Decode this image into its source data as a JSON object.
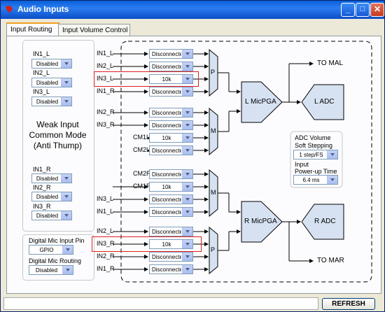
{
  "window": {
    "title": "Audio Inputs",
    "buttons": {
      "minimize": "_",
      "maximize": "□",
      "close": "✕"
    }
  },
  "tabs": [
    {
      "label": "Input Routing"
    },
    {
      "label": "Input Volume Control"
    }
  ],
  "left_panel": {
    "groups": [
      {
        "label": "IN1_L",
        "value": "Disabled"
      },
      {
        "label": "IN2_L",
        "value": "Disabled"
      },
      {
        "label": "IN3_L",
        "value": "Disabled"
      },
      {
        "label": "IN1_R",
        "value": "Disabled"
      },
      {
        "label": "IN2_R",
        "value": "Disabled"
      },
      {
        "label": "IN3_R",
        "value": "Disabled"
      }
    ],
    "weak_input_text": {
      "line1": "Weak Input",
      "line2": "Common Mode",
      "line3": "(Anti Thump)"
    },
    "digital_mic_input_pin": {
      "label": "Digital Mic Input Pin",
      "value": "GPIO"
    },
    "digital_mic_routing": {
      "label": "Digital Mic Routing",
      "value": "Disabled"
    }
  },
  "routing": {
    "rows_top": [
      {
        "label": "IN1_L",
        "value": "Disconnected"
      },
      {
        "label": "IN2_L",
        "value": "Disconnected"
      },
      {
        "label": "IN3_L",
        "value": "10k"
      },
      {
        "label": "IN1_R",
        "value": "Disconnected"
      },
      {
        "label": "IN2_R",
        "value": "Disconnected"
      },
      {
        "label": "IN3_R",
        "value": "Disconnected"
      },
      {
        "label": "CM1L",
        "value": "10k"
      },
      {
        "label": "CM2L",
        "value": "Disconnected"
      }
    ],
    "rows_bottom": [
      {
        "label": "CM2R",
        "value": "Disconnected"
      },
      {
        "label": "CM1R",
        "value": "10k"
      },
      {
        "label": "IN3_L",
        "value": "Disconnected"
      },
      {
        "label": "IN1_L",
        "value": "Disconnected"
      },
      {
        "label": "IN2_L",
        "value": "Disconnected"
      },
      {
        "label": "IN3_R",
        "value": "10k"
      },
      {
        "label": "IN2_R",
        "value": "Disconnected"
      },
      {
        "label": "IN1_R",
        "value": "Disconnected"
      }
    ],
    "mux_labels": {
      "p_top": "P",
      "m_top": "M",
      "m_bottom": "M",
      "p_bottom": "P"
    },
    "l_micpga": "L MicPGA",
    "r_micpga": "R MicPGA",
    "l_adc": "L ADC",
    "r_adc": "R ADC",
    "to_mal": "TO MAL",
    "to_mar": "TO MAR"
  },
  "adc_settings": {
    "volume_label_1": "ADC Volume",
    "volume_label_2": "Soft Stepping",
    "volume_value": "1 step/FS",
    "powerup_label_1": "Input",
    "powerup_label_2": "Power-up Time",
    "powerup_value": "6.4 ms"
  },
  "footer": {
    "refresh_label": "REFRESH",
    "status_text": ""
  }
}
